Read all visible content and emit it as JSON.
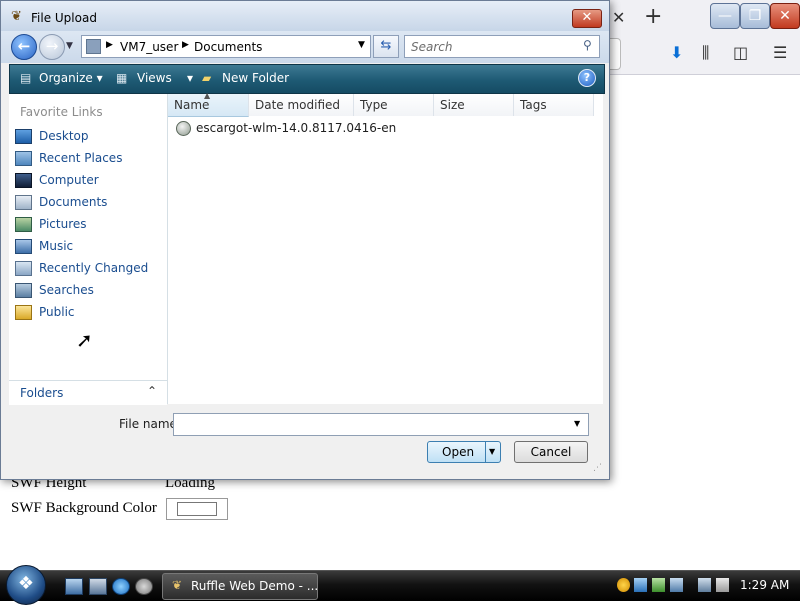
{
  "browser": {
    "tab_close_glyph": "✕",
    "new_tab_glyph": "+",
    "window_minimize": "—",
    "window_maximize": "❐",
    "window_close": "✕",
    "toolbar_icons": [
      "download-icon",
      "library-icon",
      "sidebar-icon",
      "menu-icon"
    ],
    "download_glyph": "⬇",
    "library_glyph": "⫼",
    "sidebar_glyph": "◫",
    "menu_glyph": "☰"
  },
  "page": {
    "swf_height_label": "SWF Height",
    "swf_height_value": "Loading",
    "swf_bg_label": "SWF Background Color"
  },
  "dialog": {
    "title": "File Upload",
    "close_glyph": "✕",
    "breadcrumb": [
      "VM7_user",
      "Documents"
    ],
    "search_placeholder": "Search",
    "toolbar": {
      "organize": "Organize",
      "views": "Views",
      "new_folder": "New Folder",
      "help": "?"
    },
    "nav": {
      "header": "Favorite Links",
      "items": [
        {
          "label": "Desktop",
          "icon": "desktop-icon"
        },
        {
          "label": "Recent Places",
          "icon": "recent-places-icon"
        },
        {
          "label": "Computer",
          "icon": "computer-icon"
        },
        {
          "label": "Documents",
          "icon": "documents-icon"
        },
        {
          "label": "Pictures",
          "icon": "pictures-icon"
        },
        {
          "label": "Music",
          "icon": "music-icon"
        },
        {
          "label": "Recently Changed",
          "icon": "recently-changed-icon"
        },
        {
          "label": "Searches",
          "icon": "searches-icon"
        },
        {
          "label": "Public",
          "icon": "public-icon"
        }
      ],
      "folders_label": "Folders",
      "folders_chevron": "⌃"
    },
    "columns": [
      "Name",
      "Date modified",
      "Type",
      "Size",
      "Tags"
    ],
    "files": [
      {
        "name": "escargot-wlm-14.0.8117.0416-en",
        "icon": "installer-icon"
      }
    ],
    "file_name_label": "File name:",
    "file_name_value": "",
    "open_label": "Open",
    "cancel_label": "Cancel"
  },
  "taskbar": {
    "task_label": "Ruffle Web Demo - ...",
    "clock": "1:29 AM"
  },
  "colors": {
    "command_bar": "#1e5a74",
    "link_text": "#1a4d8f",
    "close_red": "#c0391f"
  }
}
